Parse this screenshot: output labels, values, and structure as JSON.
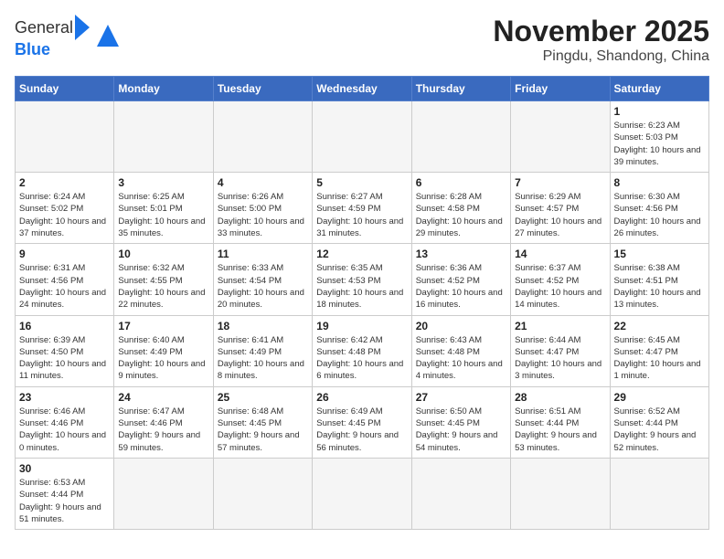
{
  "header": {
    "logo_general": "General",
    "logo_blue": "Blue",
    "title": "November 2025",
    "subtitle": "Pingdu, Shandong, China"
  },
  "calendar": {
    "days_of_week": [
      "Sunday",
      "Monday",
      "Tuesday",
      "Wednesday",
      "Thursday",
      "Friday",
      "Saturday"
    ],
    "weeks": [
      [
        {
          "day": "",
          "empty": true
        },
        {
          "day": "",
          "empty": true
        },
        {
          "day": "",
          "empty": true
        },
        {
          "day": "",
          "empty": true
        },
        {
          "day": "",
          "empty": true
        },
        {
          "day": "",
          "empty": true
        },
        {
          "day": "1",
          "sunrise": "6:23 AM",
          "sunset": "5:03 PM",
          "daylight": "10 hours and 39 minutes."
        }
      ],
      [
        {
          "day": "2",
          "sunrise": "6:24 AM",
          "sunset": "5:02 PM",
          "daylight": "10 hours and 37 minutes."
        },
        {
          "day": "3",
          "sunrise": "6:25 AM",
          "sunset": "5:01 PM",
          "daylight": "10 hours and 35 minutes."
        },
        {
          "day": "4",
          "sunrise": "6:26 AM",
          "sunset": "5:00 PM",
          "daylight": "10 hours and 33 minutes."
        },
        {
          "day": "5",
          "sunrise": "6:27 AM",
          "sunset": "4:59 PM",
          "daylight": "10 hours and 31 minutes."
        },
        {
          "day": "6",
          "sunrise": "6:28 AM",
          "sunset": "4:58 PM",
          "daylight": "10 hours and 29 minutes."
        },
        {
          "day": "7",
          "sunrise": "6:29 AM",
          "sunset": "4:57 PM",
          "daylight": "10 hours and 27 minutes."
        },
        {
          "day": "8",
          "sunrise": "6:30 AM",
          "sunset": "4:56 PM",
          "daylight": "10 hours and 26 minutes."
        }
      ],
      [
        {
          "day": "9",
          "sunrise": "6:31 AM",
          "sunset": "4:56 PM",
          "daylight": "10 hours and 24 minutes."
        },
        {
          "day": "10",
          "sunrise": "6:32 AM",
          "sunset": "4:55 PM",
          "daylight": "10 hours and 22 minutes."
        },
        {
          "day": "11",
          "sunrise": "6:33 AM",
          "sunset": "4:54 PM",
          "daylight": "10 hours and 20 minutes."
        },
        {
          "day": "12",
          "sunrise": "6:35 AM",
          "sunset": "4:53 PM",
          "daylight": "10 hours and 18 minutes."
        },
        {
          "day": "13",
          "sunrise": "6:36 AM",
          "sunset": "4:52 PM",
          "daylight": "10 hours and 16 minutes."
        },
        {
          "day": "14",
          "sunrise": "6:37 AM",
          "sunset": "4:52 PM",
          "daylight": "10 hours and 14 minutes."
        },
        {
          "day": "15",
          "sunrise": "6:38 AM",
          "sunset": "4:51 PM",
          "daylight": "10 hours and 13 minutes."
        }
      ],
      [
        {
          "day": "16",
          "sunrise": "6:39 AM",
          "sunset": "4:50 PM",
          "daylight": "10 hours and 11 minutes."
        },
        {
          "day": "17",
          "sunrise": "6:40 AM",
          "sunset": "4:49 PM",
          "daylight": "10 hours and 9 minutes."
        },
        {
          "day": "18",
          "sunrise": "6:41 AM",
          "sunset": "4:49 PM",
          "daylight": "10 hours and 8 minutes."
        },
        {
          "day": "19",
          "sunrise": "6:42 AM",
          "sunset": "4:48 PM",
          "daylight": "10 hours and 6 minutes."
        },
        {
          "day": "20",
          "sunrise": "6:43 AM",
          "sunset": "4:48 PM",
          "daylight": "10 hours and 4 minutes."
        },
        {
          "day": "21",
          "sunrise": "6:44 AM",
          "sunset": "4:47 PM",
          "daylight": "10 hours and 3 minutes."
        },
        {
          "day": "22",
          "sunrise": "6:45 AM",
          "sunset": "4:47 PM",
          "daylight": "10 hours and 1 minute."
        }
      ],
      [
        {
          "day": "23",
          "sunrise": "6:46 AM",
          "sunset": "4:46 PM",
          "daylight": "10 hours and 0 minutes."
        },
        {
          "day": "24",
          "sunrise": "6:47 AM",
          "sunset": "4:46 PM",
          "daylight": "Daylight: 9 hours and 59 minutes."
        },
        {
          "day": "25",
          "sunrise": "6:48 AM",
          "sunset": "4:45 PM",
          "daylight": "Daylight: 9 hours and 57 minutes."
        },
        {
          "day": "26",
          "sunrise": "6:49 AM",
          "sunset": "4:45 PM",
          "daylight": "Daylight: 9 hours and 56 minutes."
        },
        {
          "day": "27",
          "sunrise": "6:50 AM",
          "sunset": "4:45 PM",
          "daylight": "Daylight: 9 hours and 54 minutes."
        },
        {
          "day": "28",
          "sunrise": "6:51 AM",
          "sunset": "4:44 PM",
          "daylight": "Daylight: 9 hours and 53 minutes."
        },
        {
          "day": "29",
          "sunrise": "6:52 AM",
          "sunset": "4:44 PM",
          "daylight": "Daylight: 9 hours and 52 minutes."
        }
      ],
      [
        {
          "day": "30",
          "sunrise": "6:53 AM",
          "sunset": "4:44 PM",
          "daylight": "Daylight: 9 hours and 51 minutes."
        },
        {
          "day": "",
          "empty": true
        },
        {
          "day": "",
          "empty": true
        },
        {
          "day": "",
          "empty": true
        },
        {
          "day": "",
          "empty": true
        },
        {
          "day": "",
          "empty": true
        },
        {
          "day": "",
          "empty": true
        }
      ]
    ]
  }
}
